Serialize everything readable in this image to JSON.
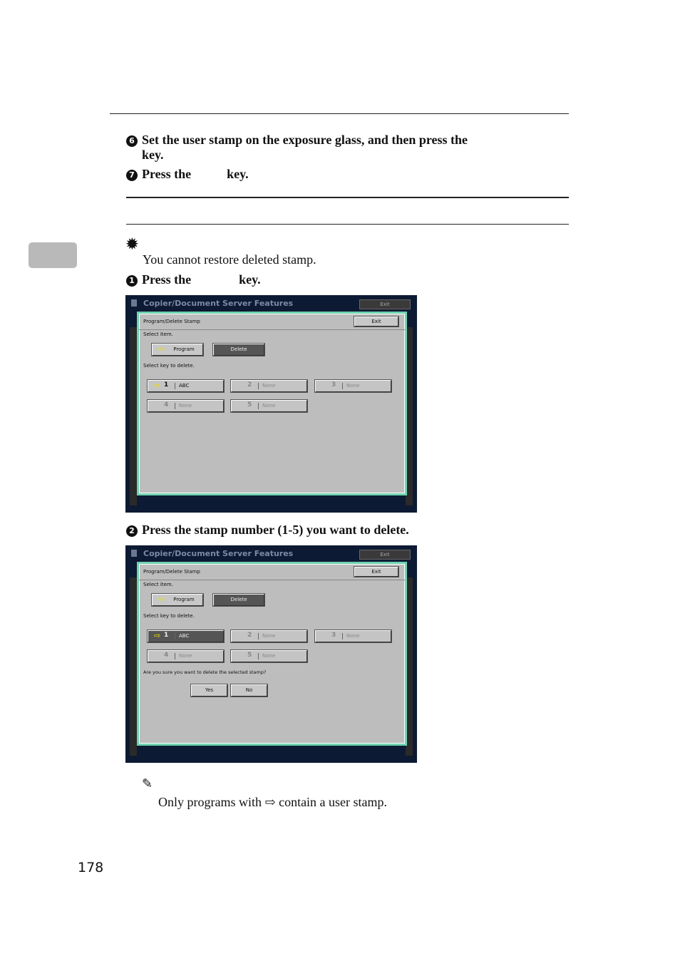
{
  "steps_before": [
    {
      "number": "6",
      "line1": "Set the user stamp on the exposure glass, and then press the",
      "line2": "key."
    },
    {
      "number": "7",
      "text_a": "Press the",
      "text_b": "key."
    }
  ],
  "important": {
    "icon": "important-icon",
    "text": "You cannot restore deleted stamp."
  },
  "step1": {
    "number": "1",
    "text_a": "Press the",
    "text_b": "key."
  },
  "step2": {
    "number": "2",
    "text": "Press the stamp number (1-5) you want to delete."
  },
  "screens": [
    {
      "title": "Copier/Document Server Features",
      "top_exit": "Exit",
      "dialog_title": "Program/Delete Stamp",
      "exit": "Exit",
      "select_item": "Select item.",
      "program": "Program",
      "delete": "Delete",
      "select_key": "Select key to delete.",
      "keys": [
        {
          "n": "1",
          "label": "ABC"
        },
        {
          "n": "2",
          "label": "None"
        },
        {
          "n": "3",
          "label": "None"
        },
        {
          "n": "4",
          "label": "None"
        },
        {
          "n": "5",
          "label": "None"
        }
      ],
      "selected_key": ""
    },
    {
      "title": "Copier/Document Server Features",
      "top_exit": "Exit",
      "dialog_title": "Program/Delete Stamp",
      "exit": "Exit",
      "select_item": "Select item.",
      "program": "Program",
      "delete": "Delete",
      "select_key": "Select key to delete.",
      "keys": [
        {
          "n": "1",
          "label": "ABC"
        },
        {
          "n": "2",
          "label": "None"
        },
        {
          "n": "3",
          "label": "None"
        },
        {
          "n": "4",
          "label": "None"
        },
        {
          "n": "5",
          "label": "None"
        }
      ],
      "selected_key": "1",
      "confirm": "Are you sure you want to delete the selected stamp?",
      "yes": "Yes",
      "no": "No"
    }
  ],
  "note": {
    "icon": "pencil-icon",
    "text_a": "Only programs with",
    "stamp_icon": "stamp-arrow-icon",
    "text_b": "contain a user stamp."
  },
  "page_number": "178"
}
